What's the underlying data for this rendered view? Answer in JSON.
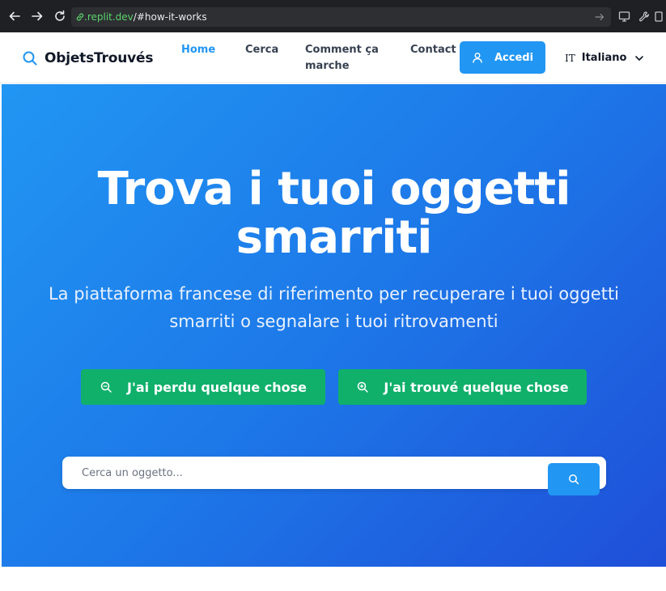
{
  "browser": {
    "url_domain": ".replit.dev",
    "url_path": "/#how-it-works"
  },
  "header": {
    "brand": "ObjetsTrouvés",
    "nav": [
      {
        "label": "Home",
        "active": true
      },
      {
        "label": "Cerca",
        "active": false
      },
      {
        "label": "Comment ça marche",
        "active": false
      },
      {
        "label": "Contact",
        "active": false
      }
    ],
    "login_label": "Accedi",
    "lang_code": "IT",
    "lang_label": "Italiano"
  },
  "hero": {
    "title": "Trova i tuoi oggetti smarriti",
    "subtitle": "La piattaforma francese di riferimento per recuperare i tuoi oggetti smarriti o segnalare i tuoi ritrovamenti",
    "lost_label": "J'ai perdu quelque chose",
    "found_label": "J'ai trouvé quelque chose",
    "search_placeholder": "Cerca un oggetto..."
  },
  "colors": {
    "primary": "#2196f3",
    "success": "#10b06b",
    "hero_start": "#2196f3",
    "hero_end": "#1f4fd8"
  },
  "icons": [
    "back-arrow-icon",
    "forward-arrow-icon",
    "reload-icon",
    "link-icon",
    "go-icon",
    "monitor-icon",
    "wrench-icon",
    "search-icon",
    "user-icon",
    "chevron-down-icon",
    "zoom-search-icon"
  ]
}
